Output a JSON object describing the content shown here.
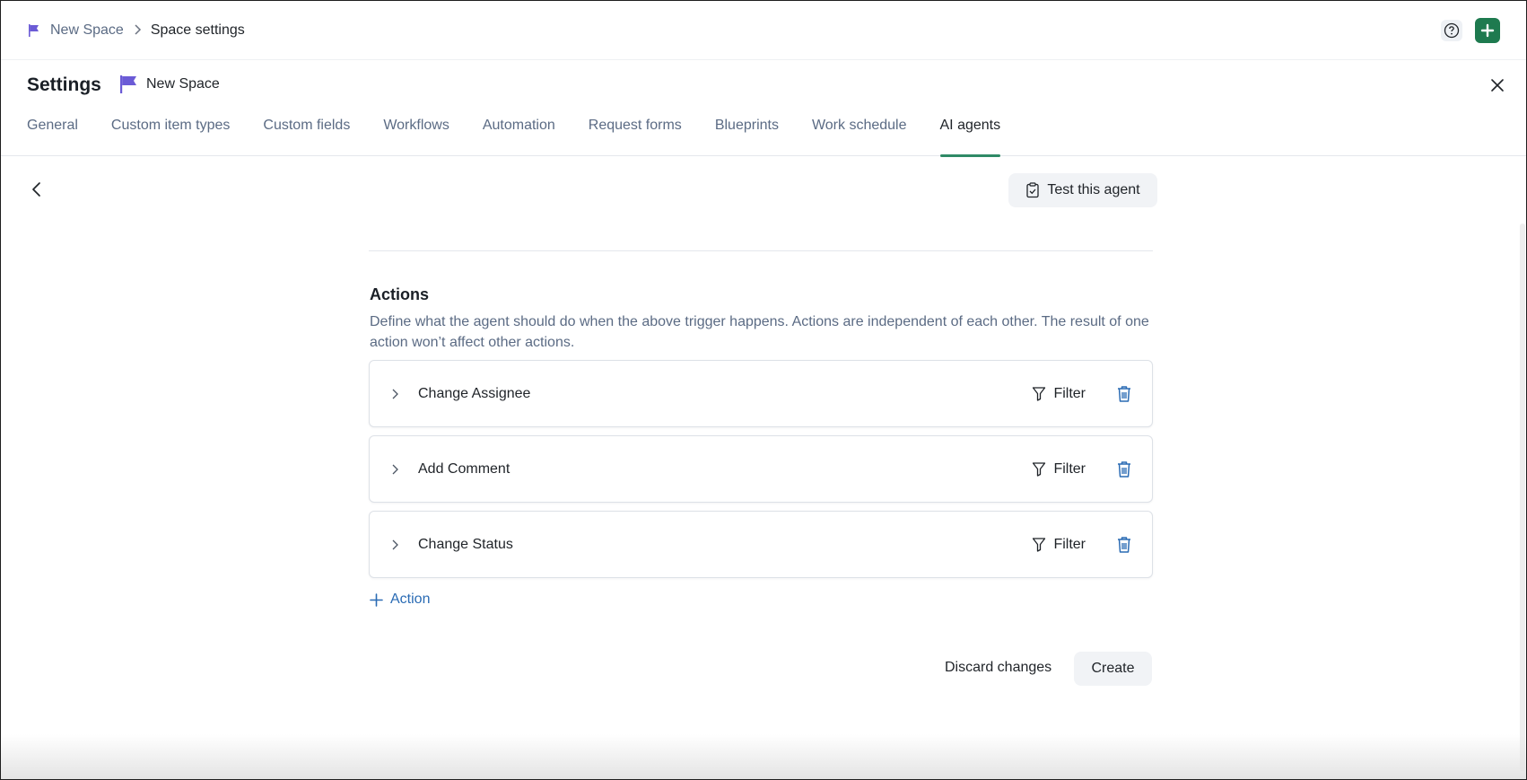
{
  "breadcrumb": {
    "space": "New Space",
    "separator_icon": "chevron-right-icon",
    "current": "Space settings"
  },
  "topbar": {
    "help_icon": "question-circle-icon",
    "add_icon": "plus-icon"
  },
  "settings": {
    "title": "Settings",
    "space_name": "New Space",
    "close_icon": "close-icon",
    "tabs": [
      {
        "label": "General"
      },
      {
        "label": "Custom item types"
      },
      {
        "label": "Custom fields"
      },
      {
        "label": "Workflows"
      },
      {
        "label": "Automation"
      },
      {
        "label": "Request forms"
      },
      {
        "label": "Blueprints"
      },
      {
        "label": "Work schedule"
      },
      {
        "label": "AI agents",
        "active": true
      }
    ]
  },
  "agent": {
    "test_label": "Test this agent",
    "actions_title": "Actions",
    "actions_description": "Define what the agent should do when the above trigger happens. Actions are independent of each other. The result of one action won’t affect other actions.",
    "actions": [
      {
        "name": "Change Assignee",
        "filter_label": "Filter"
      },
      {
        "name": "Add Comment",
        "filter_label": "Filter"
      },
      {
        "name": "Change Status",
        "filter_label": "Filter"
      }
    ],
    "add_action_label": "Action",
    "discard_label": "Discard changes",
    "create_label": "Create"
  },
  "colors": {
    "accent_green": "#1e7a4f",
    "tab_underline": "#2f8a66",
    "link_blue": "#2a6bb4",
    "flag_purple": "#6b5bd6"
  }
}
